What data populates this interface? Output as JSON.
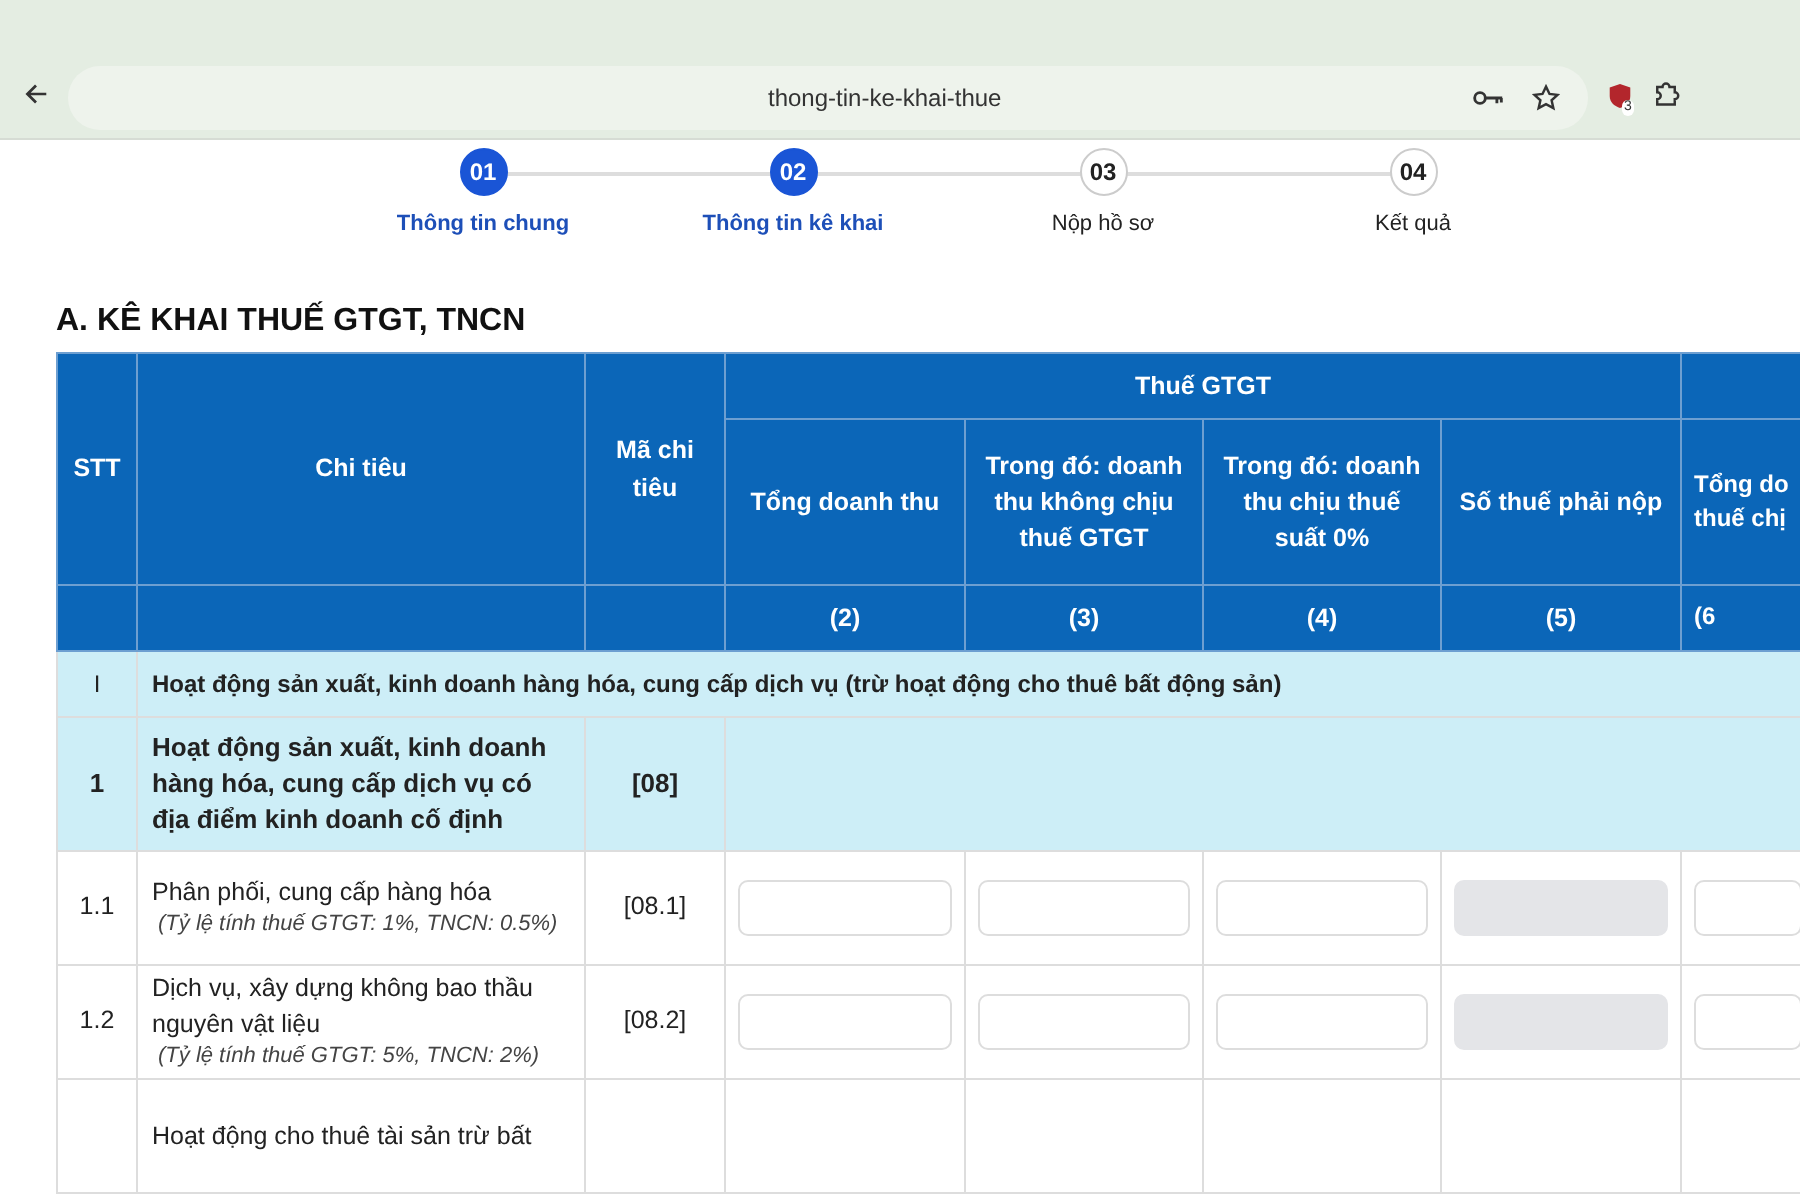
{
  "browser": {
    "url": "thong-tin-ke-khai-thue",
    "extension_badge": "3"
  },
  "steps": [
    {
      "number": "01",
      "label": "Thông tin chung",
      "completed": true
    },
    {
      "number": "02",
      "label": "Thông tin kê khai",
      "completed": true
    },
    {
      "number": "03",
      "label": "Nộp hồ sơ",
      "completed": false
    },
    {
      "number": "04",
      "label": "Kết quả",
      "completed": false
    }
  ],
  "section_title": "A. KÊ KHAI THUẾ GTGT, TNCN",
  "table": {
    "header": {
      "stt": "STT",
      "indicator": "Chi tiêu",
      "code": "Mã chi tiêu",
      "group": "Thuế GTGT",
      "columns": [
        {
          "label": "Tổng doanh thu",
          "number": "(2)"
        },
        {
          "label": "Trong đó: doanh thu không chịu thuế GTGT",
          "number": "(3)"
        },
        {
          "label": "Trong đó: doanh thu chịu thuế suất 0%",
          "number": "(4)"
        },
        {
          "label": "Số thuế phải nộp",
          "number": "(5)"
        },
        {
          "label": "Tổng do thuế chị",
          "number": "(6"
        }
      ]
    },
    "rows": [
      {
        "kind": "section",
        "stt": "I",
        "text": "Hoạt động sản xuất, kinh doanh hàng hóa, cung cấp dịch vụ (trừ hoạt động cho thuê bất động sản)"
      },
      {
        "kind": "group",
        "stt": "1",
        "text": "Hoạt động sản xuất, kinh doanh hàng hóa, cung cấp dịch vụ có địa điểm kinh doanh cố định",
        "code": "[08]"
      },
      {
        "kind": "item",
        "stt": "1.1",
        "text": "Phân phối, cung cấp hàng hóa",
        "note": "(Tỷ lệ tính thuế GTGT: 1%, TNCN: 0.5%)",
        "code": "[08.1]",
        "fields": [
          {
            "disabled": false
          },
          {
            "disabled": false
          },
          {
            "disabled": false
          },
          {
            "disabled": true
          },
          {
            "disabled": false
          }
        ]
      },
      {
        "kind": "item",
        "stt": "1.2",
        "text": "Dịch vụ, xây dựng không bao thầu nguyên vật liệu",
        "note": "(Tỷ lệ tính thuế GTGT: 5%, TNCN: 2%)",
        "code": "[08.2]",
        "fields": [
          {
            "disabled": false
          },
          {
            "disabled": false
          },
          {
            "disabled": false
          },
          {
            "disabled": true
          },
          {
            "disabled": false
          }
        ]
      },
      {
        "kind": "item",
        "stt": "",
        "text": "Hoạt động cho thuê tài sản trừ bất"
      }
    ]
  }
}
